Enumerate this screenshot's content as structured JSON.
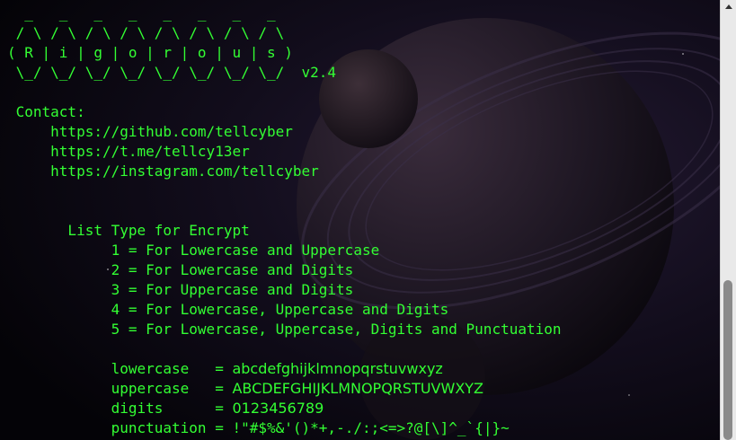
{
  "banner": {
    "line1": "  _   _   _   _   _   _   _   _",
    "line2": " / \\ / \\ / \\ / \\ / \\ / \\ / \\ / \\",
    "line3": "( R | i | g | o | r | o | u | s )",
    "line4": " \\_/ \\_/ \\_/ \\_/ \\_/ \\_/ \\_/ \\_/  v2.4"
  },
  "contact": {
    "label": " Contact:",
    "links": [
      "     https://github.com/tellcyber",
      "     https://t.me/tellcy13er",
      "     https://instagram.com/tellcyber"
    ]
  },
  "list_type": {
    "heading": "       List Type for Encrypt",
    "options": [
      "            1 = For Lowercase and Uppercase",
      "            2 = For Lowercase and Digits",
      "            3 = For Uppercase and Digits",
      "            4 = For Lowercase, Uppercase and Digits",
      "            5 = For Lowercase, Uppercase, Digits and Punctuation"
    ]
  },
  "charsets": [
    {
      "name": "            lowercase  ",
      "eq": " = ",
      "value": "abcdefghijklmnopqrstuvwxyz"
    },
    {
      "name": "            uppercase  ",
      "eq": " = ",
      "value": "ABCDEFGHIJKLMNOPQRSTUVWXYZ"
    },
    {
      "name": "            digits     ",
      "eq": " = ",
      "value": "0123456789"
    },
    {
      "name": "            punctuation",
      "eq": " = ",
      "value": "!\"#$%&'()*+,-./:;<=>?@[\\]^_`{|}~"
    }
  ],
  "colors": {
    "terminal_text": "#33ff33",
    "background": "#05040a",
    "scrollbar_track": "#e9e9e9",
    "scrollbar_thumb": "#8a8a8a"
  },
  "scrollbar": {
    "icon": "scroll-up-arrow-icon"
  }
}
